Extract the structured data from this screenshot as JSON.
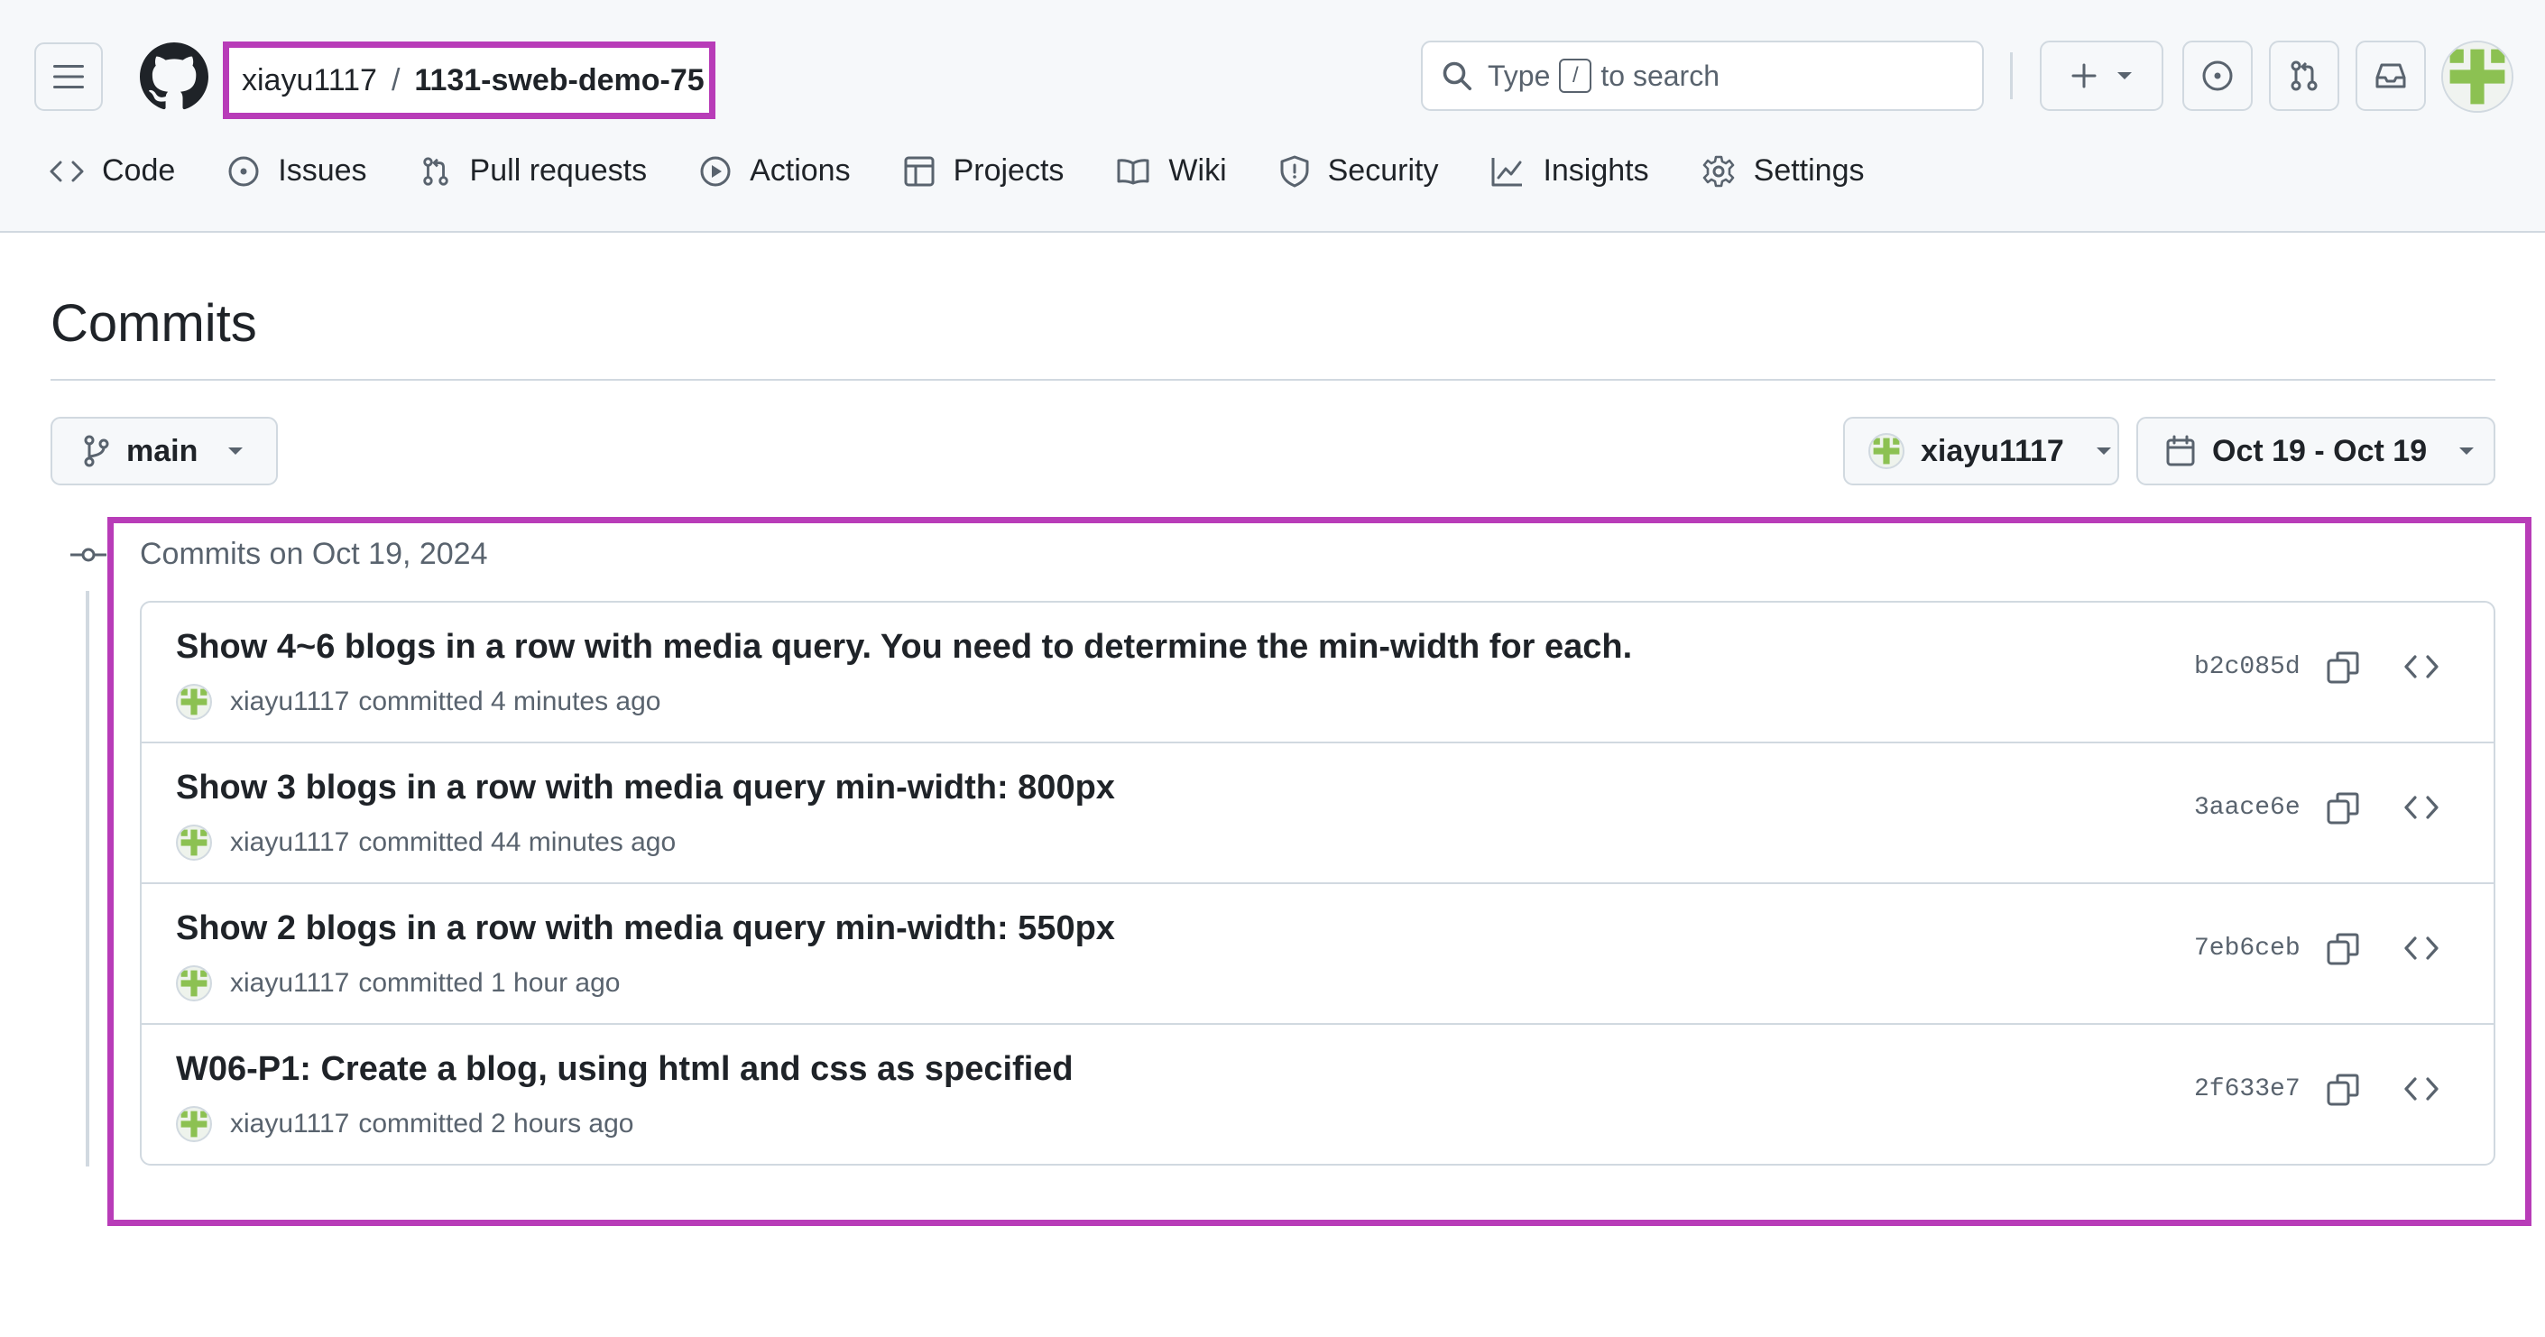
{
  "header": {
    "repo_owner": "xiayu1117",
    "repo_separator": "/",
    "repo_name": "1131-sweb-demo-75",
    "search_prefix": "Type",
    "search_key": "/",
    "search_suffix": "to search"
  },
  "tabs": [
    {
      "label": "Code",
      "icon": "code-icon"
    },
    {
      "label": "Issues",
      "icon": "issue-opened-icon"
    },
    {
      "label": "Pull requests",
      "icon": "git-pull-request-icon"
    },
    {
      "label": "Actions",
      "icon": "play-icon"
    },
    {
      "label": "Projects",
      "icon": "table-icon"
    },
    {
      "label": "Wiki",
      "icon": "book-icon"
    },
    {
      "label": "Security",
      "icon": "shield-icon"
    },
    {
      "label": "Insights",
      "icon": "graph-icon"
    },
    {
      "label": "Settings",
      "icon": "gear-icon"
    }
  ],
  "page": {
    "title": "Commits",
    "branch": "main",
    "author_filter": "xiayu1117",
    "date_filter": "Oct 19 - Oct 19"
  },
  "commit_group": {
    "date_label": "Commits on Oct 19, 2024",
    "commits": [
      {
        "message": "Show 4~6 blogs in a row with media query. You need to determine the min-width for each.",
        "author": "xiayu1117",
        "action": "committed 4 minutes ago",
        "sha": "b2c085d"
      },
      {
        "message": "Show 3 blogs in a row with media query min-width: 800px",
        "author": "xiayu1117",
        "action": "committed 44 minutes ago",
        "sha": "3aace6e"
      },
      {
        "message": "Show 2 blogs in a row with media query min-width: 550px",
        "author": "xiayu1117",
        "action": "committed 1 hour ago",
        "sha": "7eb6ceb"
      },
      {
        "message": "W06-P1: Create a blog, using html and css as specified",
        "author": "xiayu1117",
        "action": "committed 2 hours ago",
        "sha": "2f633e7"
      }
    ]
  },
  "colors": {
    "highlight": "#b83cb8",
    "avatar_green": "#8cc152",
    "border": "#d1d9e0",
    "muted_text": "#59636e"
  }
}
